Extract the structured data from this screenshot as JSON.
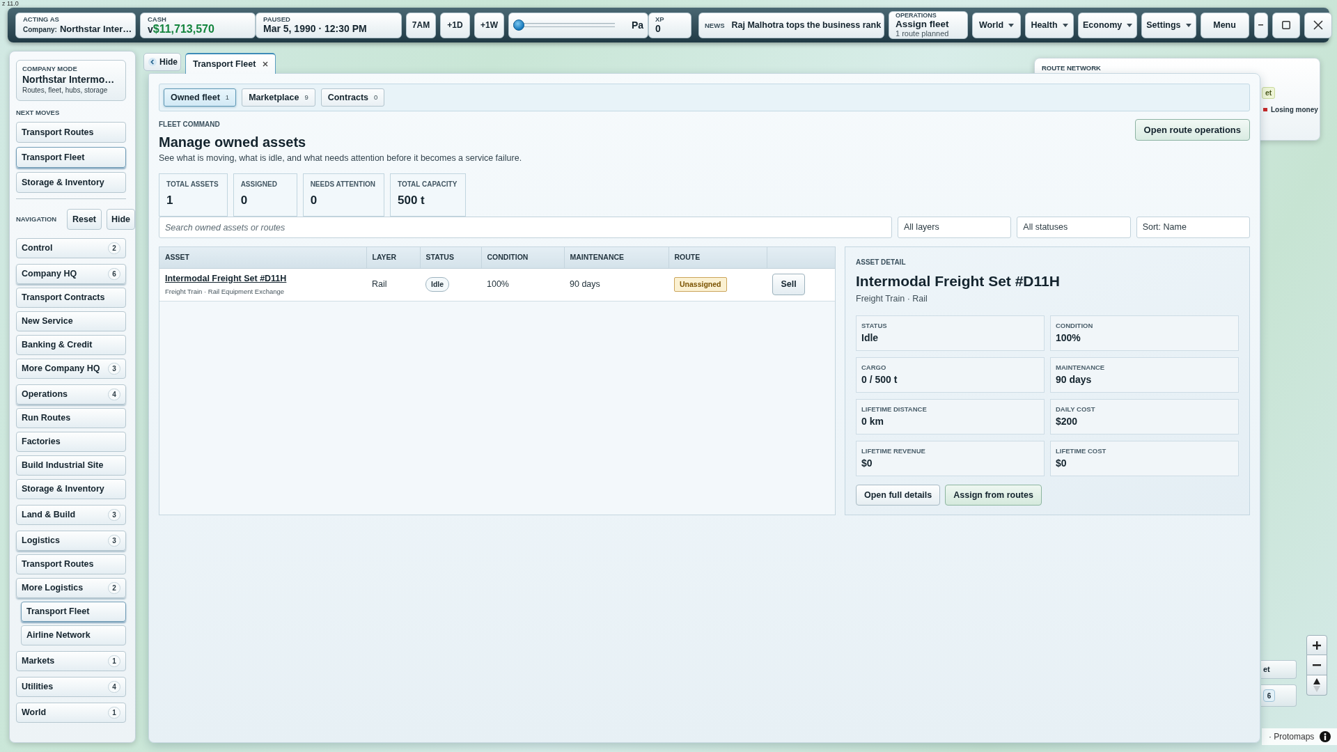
{
  "zoom_indicator": "z 11.0",
  "top_bar": {
    "acting_as": {
      "label": "ACTING AS",
      "prefix": "Company:",
      "value": "Northstar Inter…"
    },
    "cash": {
      "label": "CASH",
      "prefix": "v",
      "value": "$11,713,570"
    },
    "clock": {
      "label": "PAUSED",
      "value": "Mar 5, 1990 · 12:30 PM"
    },
    "time_buttons": [
      "7AM",
      "+1D",
      "+1W"
    ],
    "speed_slider": {
      "level": 0,
      "label": "Pa"
    },
    "xp": {
      "label": "XP",
      "value": "0"
    },
    "news": {
      "label": "NEWS",
      "headline": "Raj Malhotra tops the business rank"
    },
    "operations": {
      "label": "OPERATIONS",
      "title": "Assign fleet",
      "detail": "1 route planned"
    },
    "menus": [
      {
        "label": "World",
        "dropdown": true
      },
      {
        "label": "Health",
        "dropdown": true
      },
      {
        "label": "Economy",
        "dropdown": true
      },
      {
        "label": "Settings",
        "dropdown": true
      },
      {
        "label": "Menu",
        "dropdown": false
      }
    ]
  },
  "sidebar": {
    "company": {
      "label": "COMPANY MODE",
      "name": "Northstar Intermo…",
      "detail": "Routes, fleet, hubs, storage"
    },
    "next_moves": {
      "title": "NEXT MOVES",
      "items": [
        {
          "label": "Transport Routes",
          "selected": false
        },
        {
          "label": "Transport Fleet",
          "selected": true
        },
        {
          "label": "Storage & Inventory",
          "selected": false
        }
      ]
    },
    "navigation": {
      "title": "NAVIGATION",
      "buttons": [
        "Reset",
        "Hide"
      ],
      "items": [
        {
          "label": "Control",
          "count": "2",
          "expanded": false,
          "selected": false
        },
        {
          "label": "Company HQ",
          "count": "6",
          "expanded": true,
          "selected": false,
          "children": [
            {
              "label": "Transport Contracts",
              "selected": false
            },
            {
              "label": "New Service",
              "selected": false
            },
            {
              "label": "Banking & Credit",
              "selected": false
            },
            {
              "label": "More Company HQ",
              "count": "3",
              "expanded": false,
              "selected": false
            }
          ]
        },
        {
          "label": "Operations",
          "count": "4",
          "expanded": true,
          "selected": false,
          "children": [
            {
              "label": "Run Routes",
              "selected": false
            },
            {
              "label": "Factories",
              "selected": false
            },
            {
              "label": "Build Industrial Site",
              "selected": false
            },
            {
              "label": "Storage & Inventory",
              "selected": false
            }
          ]
        },
        {
          "label": "Land & Build",
          "count": "3",
          "expanded": false,
          "selected": false
        },
        {
          "label": "Logistics",
          "count": "3",
          "expanded": true,
          "selected": false,
          "children": [
            {
              "label": "Transport Routes",
              "selected": false
            },
            {
              "label": "More Logistics",
              "count": "2",
              "expanded": true,
              "selected": false,
              "children": [
                {
                  "label": "Transport Fleet",
                  "selected": true
                },
                {
                  "label": "Airline Network",
                  "selected": false
                }
              ]
            }
          ]
        },
        {
          "label": "Markets",
          "count": "1",
          "expanded": false,
          "selected": false
        },
        {
          "label": "Utilities",
          "count": "4",
          "expanded": false,
          "selected": false
        },
        {
          "label": "World",
          "count": "1",
          "expanded": false,
          "selected": false
        }
      ]
    }
  },
  "panel_tabs": {
    "hide_button": "Hide",
    "tabs": [
      {
        "label": "Transport Fleet",
        "selected": true
      }
    ]
  },
  "fleet": {
    "subtabs": [
      {
        "label": "Owned fleet",
        "count": "1",
        "selected": true
      },
      {
        "label": "Marketplace",
        "count": "9",
        "selected": false
      },
      {
        "label": "Contracts",
        "count": "0",
        "selected": false
      }
    ],
    "eyebrow": "FLEET COMMAND",
    "title": "Manage owned assets",
    "description": "See what is moving, what is idle, and what needs attention before it becomes a service failure.",
    "action": "Open route operations",
    "stats": [
      {
        "label": "TOTAL ASSETS",
        "value": "1"
      },
      {
        "label": "ASSIGNED",
        "value": "0"
      },
      {
        "label": "NEEDS ATTENTION",
        "value": "0"
      },
      {
        "label": "TOTAL CAPACITY",
        "value": "500 t"
      }
    ],
    "search": {
      "placeholder": "Search owned assets or routes"
    },
    "filters": [
      "All layers",
      "All statuses",
      "Sort: Name"
    ],
    "table": {
      "columns": [
        "ASSET",
        "LAYER",
        "STATUS",
        "CONDITION",
        "MAINTENANCE",
        "ROUTE"
      ],
      "rows": [
        {
          "asset": "Intermodal Freight Set #D11H",
          "subtitle": "Freight Train · Rail Equipment Exchange",
          "layer": "Rail",
          "status": "Idle",
          "condition": "100%",
          "maintenance": "90 days",
          "route": "Unassigned",
          "action": "Sell"
        }
      ]
    },
    "detail": {
      "eyebrow": "ASSET DETAIL",
      "title": "Intermodal Freight Set #D11H",
      "subtitle": "Freight Train · Rail",
      "fields": [
        {
          "label": "STATUS",
          "value": "Idle"
        },
        {
          "label": "CONDITION",
          "value": "100%"
        },
        {
          "label": "CARGO",
          "value": "0 / 500 t"
        },
        {
          "label": "MAINTENANCE",
          "value": "90 days"
        },
        {
          "label": "LIFETIME DISTANCE",
          "value": "0 km"
        },
        {
          "label": "DAILY COST",
          "value": "$200"
        },
        {
          "label": "LIFETIME REVENUE",
          "value": "$0"
        },
        {
          "label": "LIFETIME COST",
          "value": "$0"
        }
      ],
      "buttons": [
        {
          "label": "Open full details",
          "kind": "default"
        },
        {
          "label": "Assign from routes",
          "kind": "primary"
        }
      ]
    }
  },
  "route_network": {
    "title": "ROUTE NETWORK",
    "tag": "et",
    "legend": [
      {
        "label": "Losing money",
        "color": "#c62828"
      }
    ]
  },
  "map_overlay": {
    "cards": [
      {
        "label": "et"
      },
      {
        "count": "6"
      }
    ],
    "attribution": "· Protomaps"
  }
}
